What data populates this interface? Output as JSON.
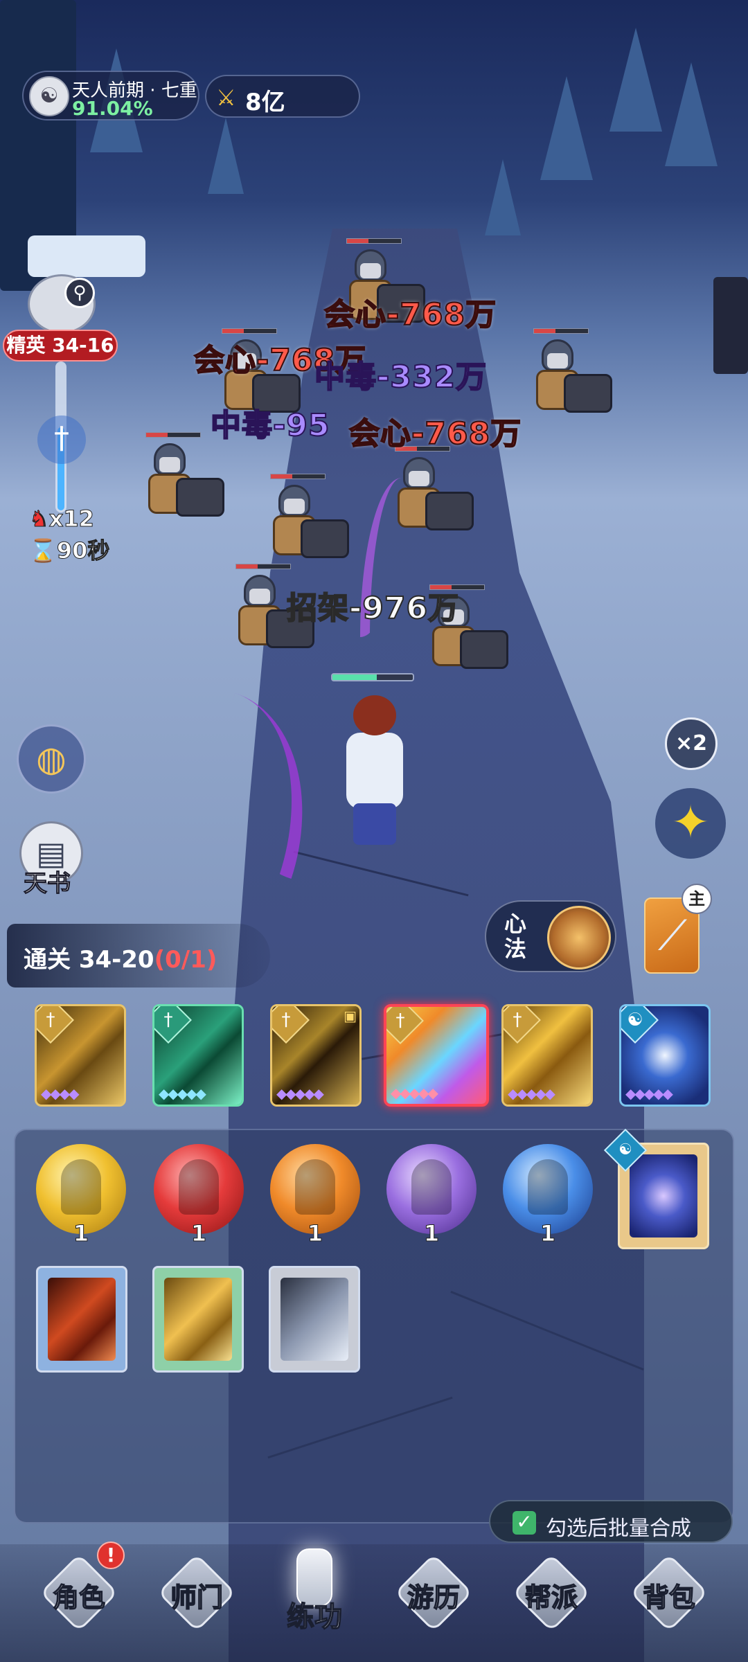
{
  "hud": {
    "rank_title": "天人前期 · 七重",
    "rank_progress": "91.04%",
    "power_value": "8亿",
    "stage_label": "精英 34-16",
    "kill_count": "x12",
    "time_left": "90秒"
  },
  "combat_text": {
    "crit_1": "会心-768万",
    "crit_2": "会心-768万",
    "poison_1": "中毒-332万",
    "poison_2": "中毒-95",
    "crit_3": "会心-768万",
    "parry": "招架-976万"
  },
  "side": {
    "book_label": "天书",
    "speed_label": "×2",
    "mind_label": "心法",
    "weapon_tag": "主"
  },
  "clear_goal": {
    "text": "通关 34-20",
    "progress": "(0/1)"
  },
  "skills": [
    {
      "name": "golden-blade-skill",
      "stars": "◆◆◆◆"
    },
    {
      "name": "jade-blade-skill",
      "stars": "◆◆◆◆◆"
    },
    {
      "name": "dark-gold-blade-skill",
      "stars": "◆◆◆◆◆"
    },
    {
      "name": "rainbow-slash-skill",
      "stars": "◆◆◆◆◆"
    },
    {
      "name": "sunburst-blade-skill",
      "stars": "◆◆◆◆◆"
    },
    {
      "name": "taiji-skill",
      "stars": "◆◆◆◆◆"
    }
  ],
  "inventory": {
    "orbs": [
      {
        "color": "#f0c030",
        "count": "1"
      },
      {
        "color": "#e53b3b",
        "count": "1"
      },
      {
        "color": "#f08a2a",
        "count": "1"
      },
      {
        "color": "#9a6fe0",
        "count": "1"
      },
      {
        "color": "#4a8ee8",
        "count": "1"
      }
    ]
  },
  "batch_merge": {
    "label": "勾选后批量合成",
    "checked": true
  },
  "nav": [
    {
      "label": "角色",
      "badge": "!"
    },
    {
      "label": "师门"
    },
    {
      "label": "练功",
      "active": true
    },
    {
      "label": "游历"
    },
    {
      "label": "帮派"
    },
    {
      "label": "背包"
    }
  ]
}
